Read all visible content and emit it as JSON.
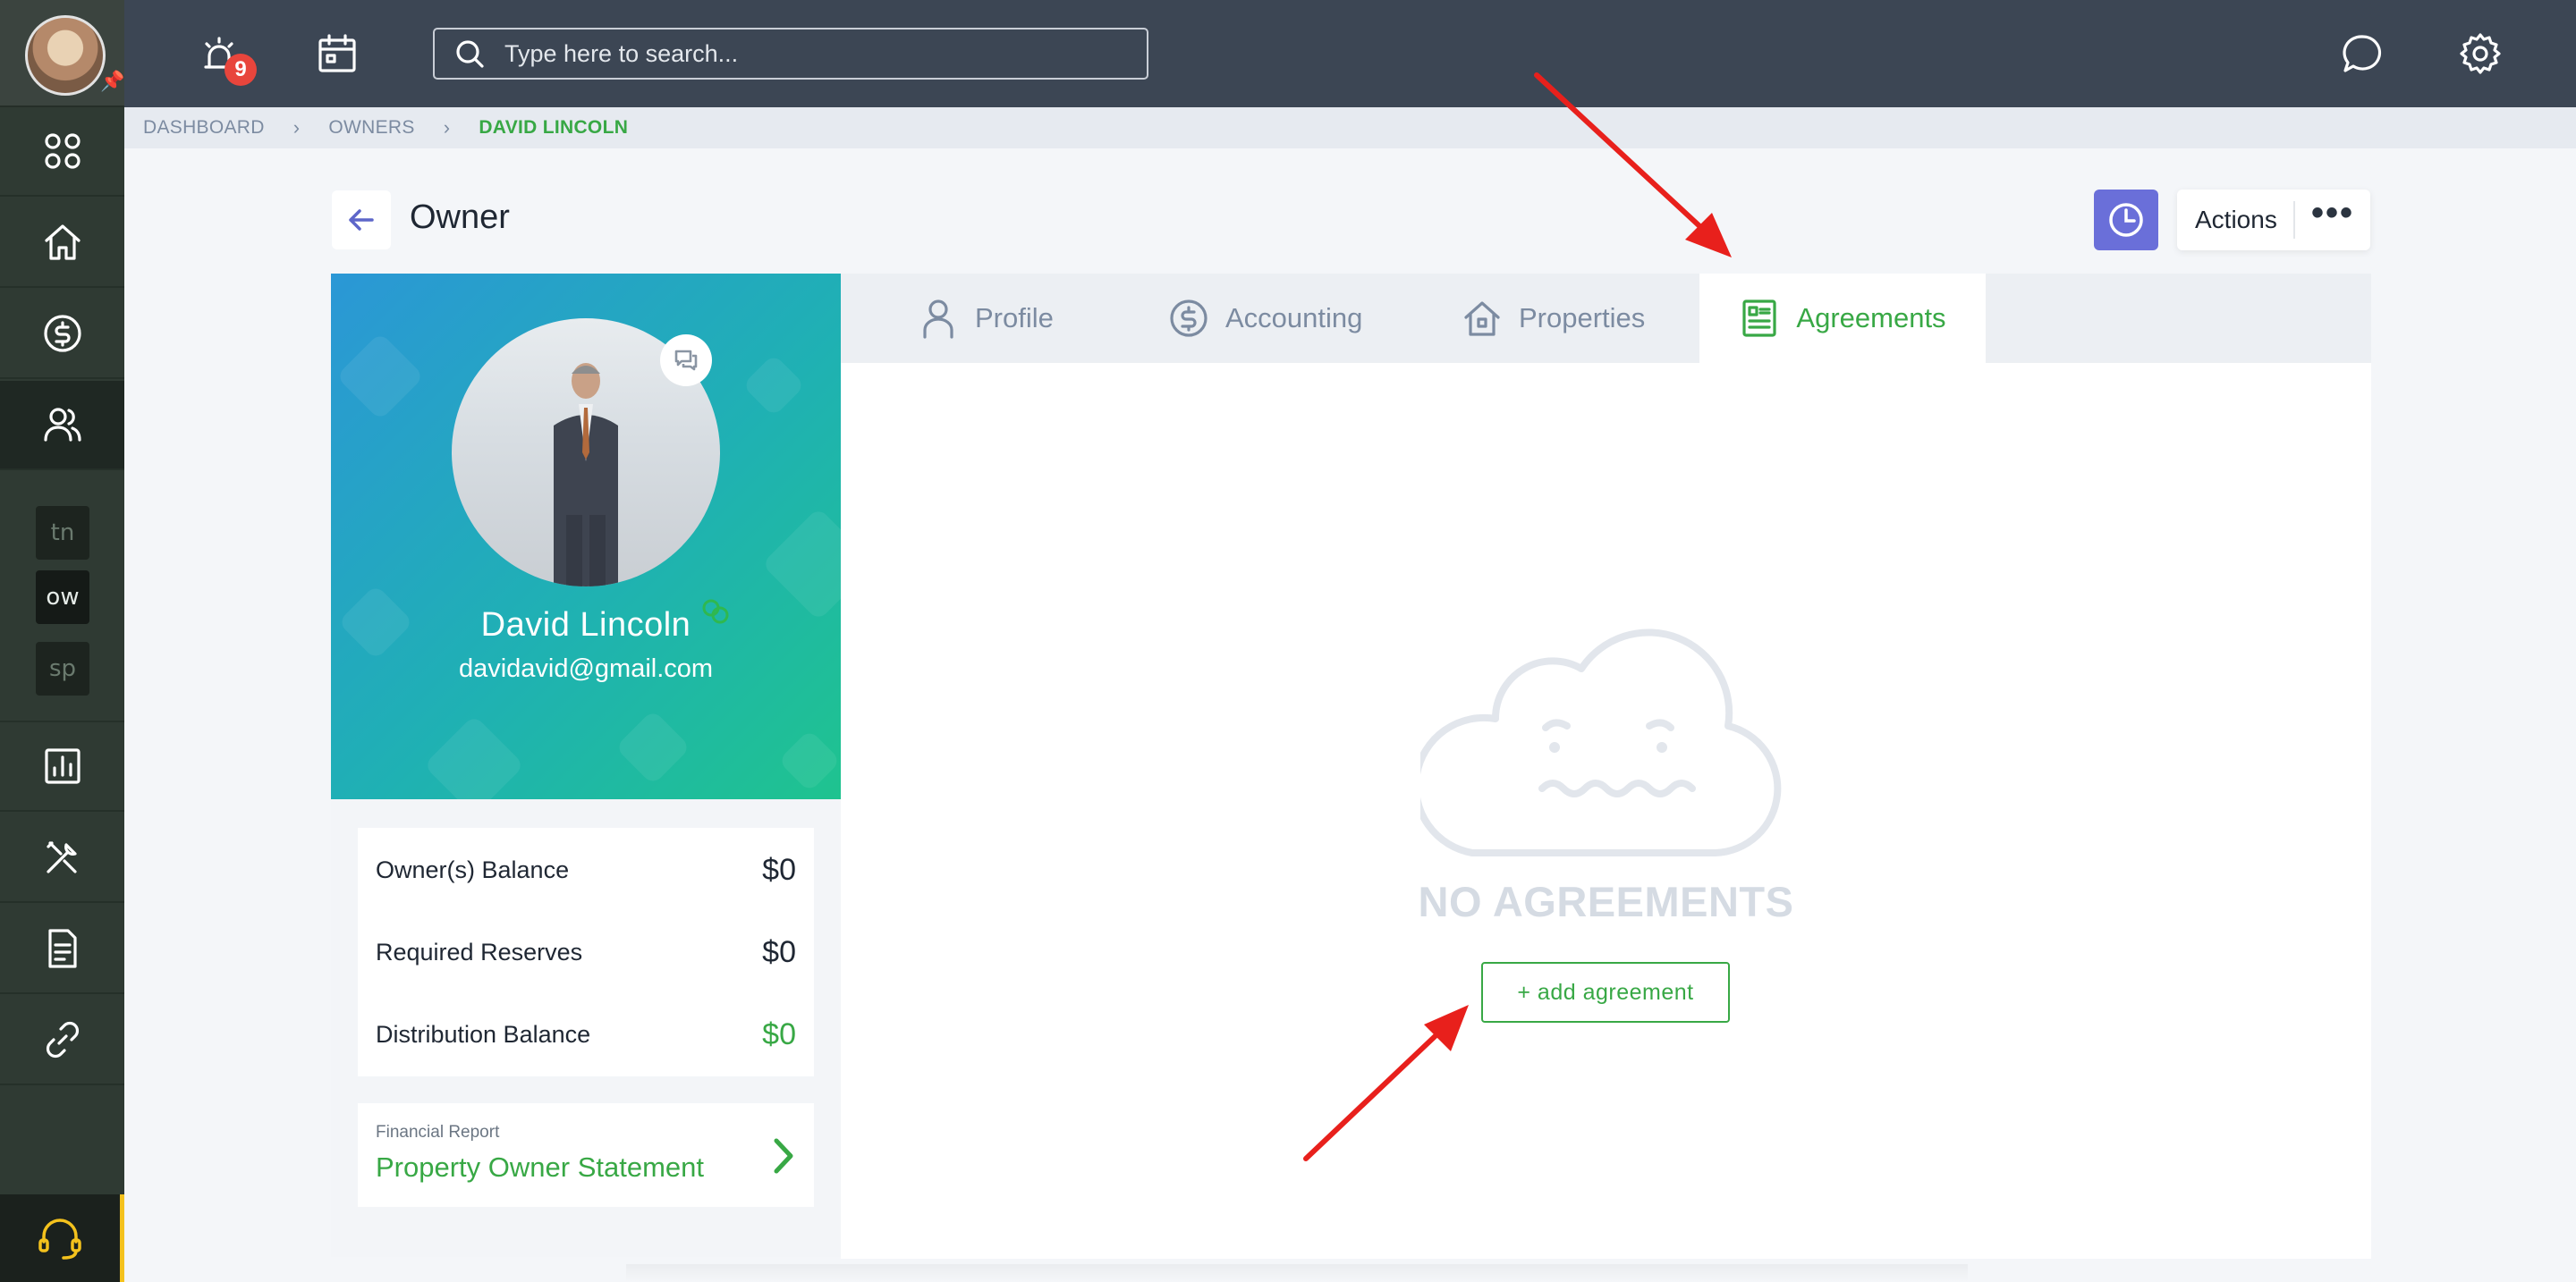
{
  "topbar": {
    "notification_count": "9",
    "search_placeholder": "Type here to search..."
  },
  "sidebar": {
    "shortcuts": [
      "tn",
      "ow",
      "sp"
    ],
    "selected_shortcut": "ow"
  },
  "breadcrumb": {
    "items": [
      "DASHBOARD",
      "OWNERS"
    ],
    "current": "DAVID LINCOLN"
  },
  "page": {
    "title": "Owner",
    "actions_label": "Actions",
    "more_label": "•••"
  },
  "owner": {
    "name": "David Lincoln",
    "email": "davidavid@gmail.com"
  },
  "balances": [
    {
      "label": "Owner(s) Balance",
      "value": "$0",
      "color": "#1f2733"
    },
    {
      "label": "Required Reserves",
      "value": "$0",
      "color": "#1f2733"
    },
    {
      "label": "Distribution Balance",
      "value": "$0",
      "color": "#38a845"
    }
  ],
  "report": {
    "caption": "Financial Report",
    "title": "Property Owner Statement"
  },
  "tabs": [
    {
      "label": "Profile",
      "icon": "user-icon",
      "active": false
    },
    {
      "label": "Accounting",
      "icon": "dollar-circle-icon",
      "active": false
    },
    {
      "label": "Properties",
      "icon": "house-icon",
      "active": false
    },
    {
      "label": "Agreements",
      "icon": "document-list-icon",
      "active": true
    }
  ],
  "empty_state": {
    "title": "NO AGREEMENTS",
    "button_label": "+ add agreement",
    "icon": "sad-cloud-icon"
  },
  "colors": {
    "accent_green": "#38a845",
    "topbar": "#3c4654",
    "sidebar": "#2f3a33",
    "clock_button": "#6a6fd9",
    "annotation_arrow": "#e8201c"
  }
}
